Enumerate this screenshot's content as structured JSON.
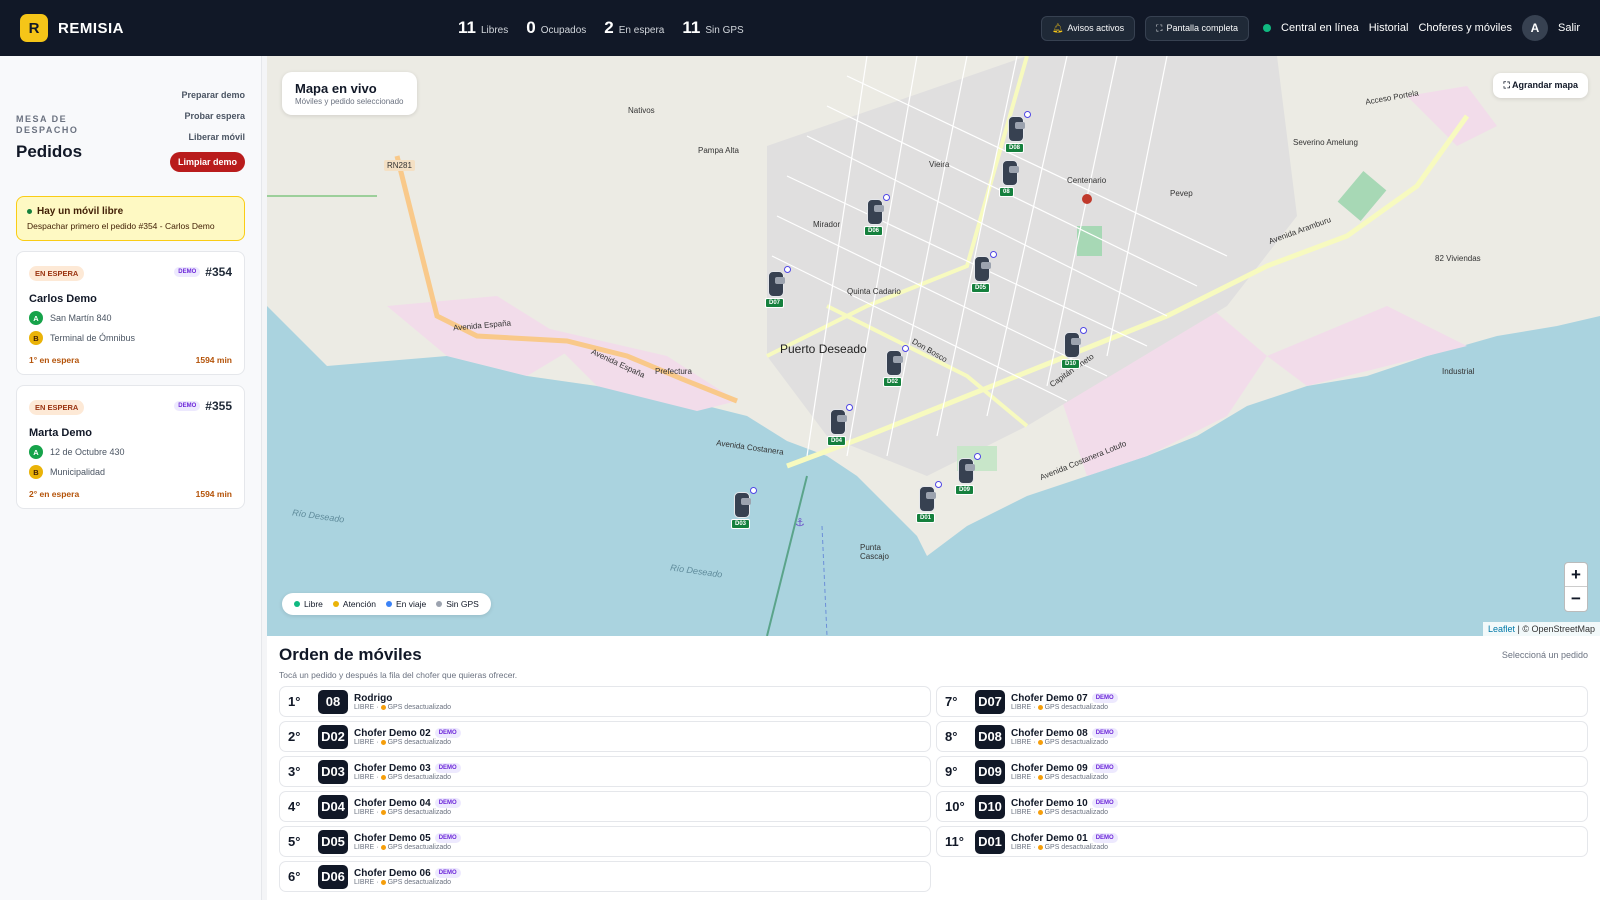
{
  "app": {
    "logo_letter": "R",
    "name": "REMISIA"
  },
  "header": {
    "stats": [
      {
        "value": "11",
        "label": "Libres"
      },
      {
        "value": "0",
        "label": "Ocupados"
      },
      {
        "value": "2",
        "label": "En espera"
      },
      {
        "value": "11",
        "label": "Sin GPS"
      }
    ],
    "alerts_button": "Avisos activos",
    "fullscreen_button": "Pantalla completa",
    "online_label": "Central en línea",
    "nav": {
      "history": "Historial",
      "drivers": "Choferes y móviles"
    },
    "avatar_letter": "A",
    "logout": "Salir"
  },
  "sidebar": {
    "section_label": "MESA DE DESPACHO",
    "title": "Pedidos",
    "actions": {
      "prepare": "Preparar demo",
      "test_wait": "Probar espera",
      "release": "Liberar móvil",
      "clear": "Limpiar demo"
    },
    "alert": {
      "title": "Hay un móvil libre",
      "subtitle": "Despachar primero el pedido #354 - Carlos Demo"
    },
    "orders": [
      {
        "status": "EN ESPERA",
        "badge": "DEMO",
        "id": "#354",
        "name": "Carlos Demo",
        "from": "San Martín 840",
        "to": "Terminal de Ómnibus",
        "queue": "1° en espera",
        "elapsed": "1594 min"
      },
      {
        "status": "EN ESPERA",
        "badge": "DEMO",
        "id": "#355",
        "name": "Marta Demo",
        "from": "12 de Octubre 430",
        "to": "Municipalidad",
        "queue": "2° en espera",
        "elapsed": "1594 min"
      }
    ]
  },
  "map": {
    "card_title": "Mapa en vivo",
    "card_subtitle": "Móviles y pedido seleccionado",
    "enlarge_button": "Agrandar mapa",
    "legend": [
      {
        "label": "Libre",
        "color": "#10b981"
      },
      {
        "label": "Atención",
        "color": "#eab308"
      },
      {
        "label": "En viaje",
        "color": "#3b82f6"
      },
      {
        "label": "Sin GPS",
        "color": "#9ca3af"
      }
    ],
    "zoom_in": "+",
    "zoom_out": "−",
    "attribution_leaflet": "Leaflet",
    "attribution_rest": "| © OpenStreetMap",
    "labels": {
      "city": "Puerto Deseado",
      "mirador": "Mirador",
      "quinta": "Quinta Cadario",
      "industrial": "Industrial",
      "viviendas": "82 Viviendas",
      "centenario": "Centenario",
      "pevep": "Pevep",
      "severino": "Severino Amelung",
      "prefectura": "Prefectura",
      "punta": "Punta Cascajo",
      "rn281": "RN281",
      "av_espana": "Avenida España",
      "av_espana2": "Avenida España",
      "av_costanera": "Avenida Costanera",
      "av_costanera_lotufo": "Avenida Costanera Lotufo",
      "av_aramburu": "Avenida Aramburu",
      "rio1": "Río Deseado",
      "rio2": "Río Deseado",
      "nativos": "Nativos",
      "vieira": "Vieira",
      "acceso": "Acceso Portela",
      "pampa_alta": "Pampa Alta",
      "don_bosco": "Don Bosco",
      "capitan": "Capitán Oneto"
    },
    "cars": [
      {
        "tag": "D08"
      },
      {
        "tag": "08"
      },
      {
        "tag": "D06"
      },
      {
        "tag": "D05"
      },
      {
        "tag": "D07"
      },
      {
        "tag": "D10"
      },
      {
        "tag": "D02"
      },
      {
        "tag": "D04"
      },
      {
        "tag": "D09"
      },
      {
        "tag": "D01"
      },
      {
        "tag": "D03"
      }
    ]
  },
  "ranking": {
    "title": "Orden de móviles",
    "hint": "Tocá un pedido y después la fila del chofer que quieras ofrecer.",
    "select_prompt": "Seleccioná un pedido",
    "left": [
      {
        "pos": "1°",
        "unit": "08",
        "name": "Rodrigo",
        "demo": "",
        "status": "LIBRE",
        "gps": "GPS desactualizado"
      },
      {
        "pos": "2°",
        "unit": "D02",
        "name": "Chofer Demo 02",
        "demo": "DEMO",
        "status": "LIBRE",
        "gps": "GPS desactualizado"
      },
      {
        "pos": "3°",
        "unit": "D03",
        "name": "Chofer Demo 03",
        "demo": "DEMO",
        "status": "LIBRE",
        "gps": "GPS desactualizado"
      },
      {
        "pos": "4°",
        "unit": "D04",
        "name": "Chofer Demo 04",
        "demo": "DEMO",
        "status": "LIBRE",
        "gps": "GPS desactualizado"
      },
      {
        "pos": "5°",
        "unit": "D05",
        "name": "Chofer Demo 05",
        "demo": "DEMO",
        "status": "LIBRE",
        "gps": "GPS desactualizado"
      },
      {
        "pos": "6°",
        "unit": "D06",
        "name": "Chofer Demo 06",
        "demo": "DEMO",
        "status": "LIBRE",
        "gps": "GPS desactualizado"
      }
    ],
    "right": [
      {
        "pos": "7°",
        "unit": "D07",
        "name": "Chofer Demo 07",
        "demo": "DEMO",
        "status": "LIBRE",
        "gps": "GPS desactualizado"
      },
      {
        "pos": "8°",
        "unit": "D08",
        "name": "Chofer Demo 08",
        "demo": "DEMO",
        "status": "LIBRE",
        "gps": "GPS desactualizado"
      },
      {
        "pos": "9°",
        "unit": "D09",
        "name": "Chofer Demo 09",
        "demo": "DEMO",
        "status": "LIBRE",
        "gps": "GPS desactualizado"
      },
      {
        "pos": "10°",
        "unit": "D10",
        "name": "Chofer Demo 10",
        "demo": "DEMO",
        "status": "LIBRE",
        "gps": "GPS desactualizado"
      },
      {
        "pos": "11°",
        "unit": "D01",
        "name": "Chofer Demo 01",
        "demo": "DEMO",
        "status": "LIBRE",
        "gps": "GPS desactualizado"
      }
    ]
  }
}
